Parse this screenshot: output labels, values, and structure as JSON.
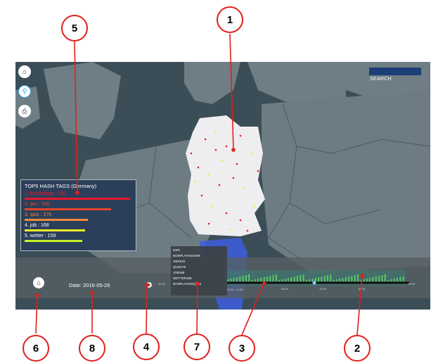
{
  "search": {
    "label": "SEARCH"
  },
  "top5": {
    "title": "TOP5 HASH TAGS (Germany)",
    "tags": [
      {
        "label": "1. bundesliga : 292",
        "color": "#e8192c",
        "value": 292
      },
      {
        "label": "2. ger : 240",
        "color": "#e8452a",
        "value": 240
      },
      {
        "label": "3. quiz : 176",
        "color": "#f08a3a",
        "value": 176
      },
      {
        "label": "4. job : 168",
        "color": "#f2ec2a",
        "value": 168
      },
      {
        "label": "5. wetter : 159",
        "color": "#c8f02a",
        "value": 159
      }
    ]
  },
  "timeline": {
    "date": "Date: 2016-05-25",
    "tooltip": "00:00 - 14:00",
    "ticks": [
      "00:00",
      "06:00",
      "12:00",
      "18:00",
      "00:00"
    ]
  },
  "dropdown": {
    "items": [
      "GER",
      "NONPLAYINGGER",
      "GER240",
      "QUIZ176",
      "JOB168",
      "WETTER159",
      "NONPLAYINGQ182"
    ]
  },
  "callouts": [
    "1",
    "2",
    "3",
    "4",
    "5",
    "6",
    "7",
    "8"
  ],
  "icons": [
    "home-icon",
    "zoom-icon",
    "print-icon",
    "home-timeline-icon",
    "play-icon"
  ],
  "colors": {
    "map_sea": "#3b4e57",
    "germany": "#eeeef0",
    "panel": "#2b3f5a",
    "callout_border": "#e0201a"
  }
}
